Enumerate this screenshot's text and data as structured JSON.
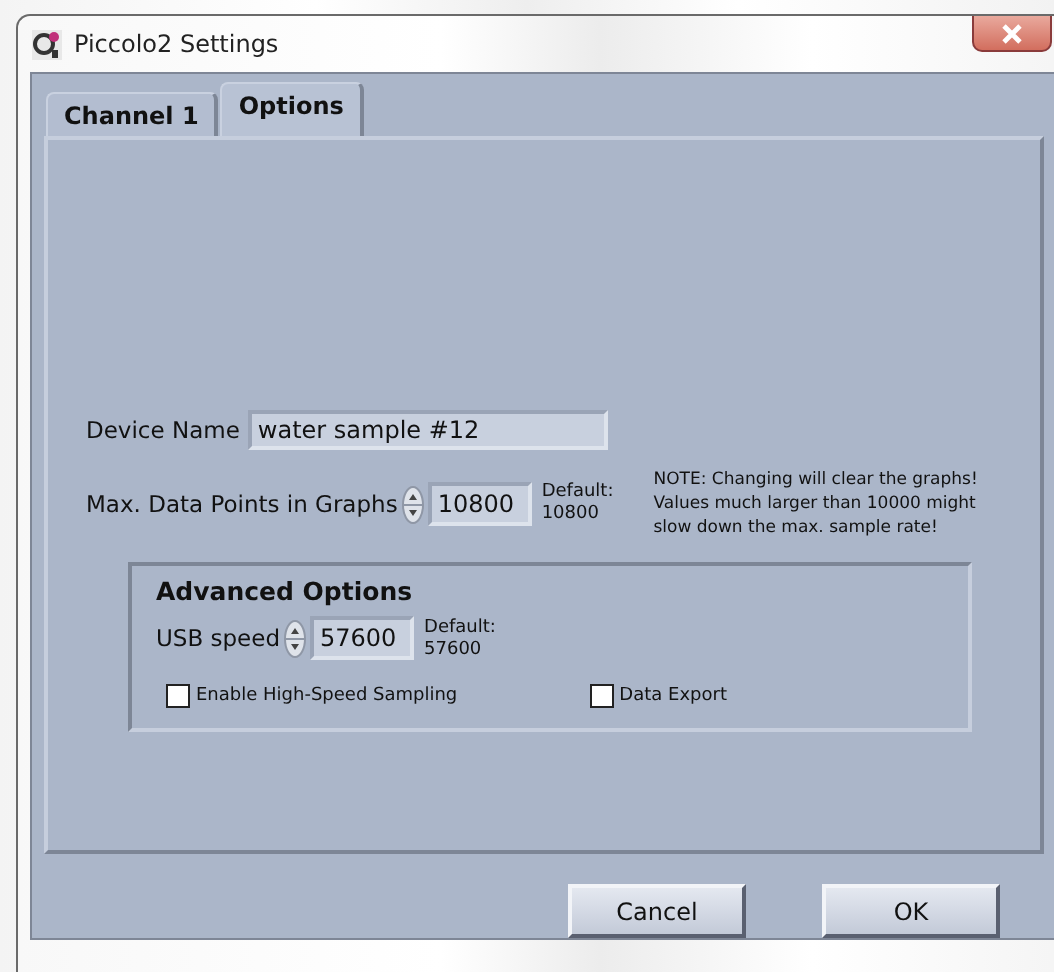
{
  "window": {
    "title": "Piccolo2 Settings"
  },
  "tabs": [
    {
      "label": "Channel 1",
      "selected": false
    },
    {
      "label": "Options",
      "selected": true
    }
  ],
  "device_name": {
    "label": "Device Name",
    "value": "water sample #12"
  },
  "max_data_points": {
    "label": "Max. Data Points in Graphs",
    "value": "10800",
    "default_label": "Default:",
    "default_value": "10800",
    "note": "NOTE: Changing will clear the graphs!\nValues much larger than 10000 might\nslow down the max. sample rate!"
  },
  "advanced": {
    "title": "Advanced Options",
    "usb_speed": {
      "label": "USB speed",
      "value": "57600",
      "default_label": "Default:",
      "default_value": "57600"
    },
    "checkboxes": [
      {
        "label": "Enable High-Speed Sampling",
        "checked": false
      },
      {
        "label": "Data Export",
        "checked": false
      }
    ]
  },
  "buttons": [
    {
      "label": "Cancel"
    },
    {
      "label": "OK"
    }
  ]
}
